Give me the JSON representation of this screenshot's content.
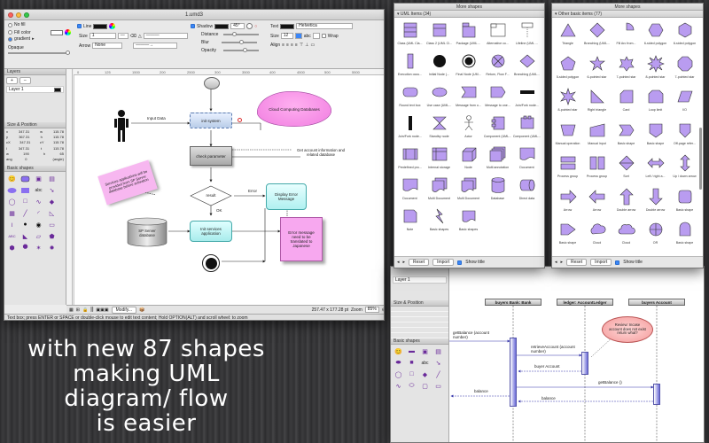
{
  "main_window": {
    "title": "1.umd3",
    "inspector": {
      "fill_options": [
        "No fill",
        "Fill color",
        "gradient"
      ],
      "opaque_label": "Opaque",
      "line_label": "Line",
      "size_label": "Size",
      "size_value": "1",
      "arrow_label": "Arrow",
      "arrow_value": "None",
      "shadow_label": "Shadow",
      "shadow_angle": "45°",
      "distance_label": "Distance",
      "blur_label": "Blur",
      "opacity_label": "Opacity",
      "text_label": "Text",
      "font_value": "Helvetica",
      "text_size_label": "Size",
      "text_size_value": "12",
      "wrap_label": "Wrap",
      "align_label": "Align"
    },
    "layers": {
      "title": "Layers",
      "add": "+",
      "remove": "–",
      "item": "Layer 1"
    },
    "size_position": {
      "title": "Size & Position",
      "rows": [
        {
          "k": "x",
          "v": "347.31",
          "k2": "w",
          "v2": "115.78"
        },
        {
          "k": "y",
          "v": "367.31",
          "k2": "h",
          "v2": "115.78"
        },
        {
          "k": "cX",
          "v": "347.31",
          "k2": "cY",
          "v2": "115.78"
        },
        {
          "k": "l",
          "v": "347.31",
          "k2": "t",
          "v2": "115.78"
        },
        {
          "k": "w",
          "v": "190",
          "k2": "h",
          "v2": "65"
        },
        {
          "k": "ang",
          "v": "0",
          "k2": "",
          "v2": "(angle)"
        }
      ]
    },
    "basic_shapes_title": "Basic shapes",
    "ruler_marks": [
      "0",
      "125",
      "1500",
      "200",
      "2500",
      "300",
      "3500",
      "400",
      "4500",
      "500",
      "5500"
    ],
    "diagram": {
      "input_data": "Input Data",
      "init_system": "init system",
      "check_parameter": "check parameter",
      "cloud": "Cloud Computing Databases",
      "get_account": "Get account information and related database",
      "note_left": "Services applications will be provided from SP Server database before activation",
      "result": "result",
      "error": "Error",
      "display_error": "Display Error Message",
      "ok": "OK",
      "sp_server": "SP Server database",
      "init_services": "Init services application",
      "error_note": "Error message need to be translated to Japanese"
    },
    "toolbar": {
      "modify": "Modify...",
      "coords": "257.47 x 177.28 pt",
      "zoom_label": "Zoom",
      "zoom_value": "85%"
    },
    "status": "Text box; press ENTER or SPACE or double-click mouse to edit text content; Hold OPTION(ALT) and scroll wheel: to zoom"
  },
  "uml_library": {
    "window_title": "More shapes",
    "section": "UML Items (34)",
    "items": [
      "Class (UML Cla...",
      "Class 2 (UML Cl...",
      "Package (UML ...",
      "Alternative co...",
      "Lifeline (UML ...",
      "Execution occu...",
      "Initial Node (...",
      "Final Node (UM...",
      "Return, Flow F...",
      "Branching (UML...",
      "Round text box",
      "Use case (UML...",
      "Message from o...",
      "Message to one...",
      "Join/Fork node...",
      "Join/Fork node...",
      "Standby node",
      "Actor",
      "Component (UML...",
      "Component (UML...",
      "Predefined pro...",
      "Internal storage",
      "Node",
      "Multi annotation",
      "Document",
      "Document",
      "Multi Document",
      "Multi Document",
      "Database",
      "Direct data",
      "Note",
      "Basic shapes",
      "Basic shapes"
    ],
    "reset": "Reset",
    "import": "Import",
    "show_title": "Show title"
  },
  "basic_library": {
    "window_title": "More shapes",
    "section": "Other basic items (77)",
    "items": [
      "Triangle",
      "Branching (UML...",
      "Fill Arc from...",
      "6-sided polygon",
      "6-sided polygon",
      "5-sided polygon",
      "6-pointed star",
      "7-pointed star",
      "8-pointed star",
      "7-pointed star",
      "8-pointed star",
      "Right triangle",
      "Card",
      "Loop limit",
      "I/O",
      "Manual operation",
      "Manual input",
      "Basic shape",
      "Basic shape",
      "Off-page refer...",
      "Process group",
      "Process group",
      "Sort",
      "Left / right a...",
      "Up / down arrow",
      "Arrow",
      "Arrow",
      "Double arrow",
      "Double arrow",
      "Basic shape",
      "Basic shape",
      "Cloud",
      "Cloud",
      "OR",
      "Basic shape"
    ],
    "reset": "Reset",
    "import": "Import",
    "show_title": "Show title"
  },
  "second_window": {
    "layers_item": "Layer 1",
    "size_position": "Size & Position",
    "basic_shapes": "Basic shapes",
    "sequence": {
      "lifeline1": "buyers Bank: Bank",
      "lifeline2": "ledger: AccountLedger",
      "lifeline3": "buyers Account",
      "msg1": "getBalance (account number)",
      "msg2": "retrieveAccount (account number)",
      "msg3": "buyer Account",
      "msg4": "getBalance ()",
      "msg5": "balance",
      "msg6": "balance",
      "note": "Review: Incase account does not exist return what?"
    }
  },
  "caption": [
    "with new 87 shapes",
    "making UML",
    "diagram/ flow",
    "is easier"
  ]
}
